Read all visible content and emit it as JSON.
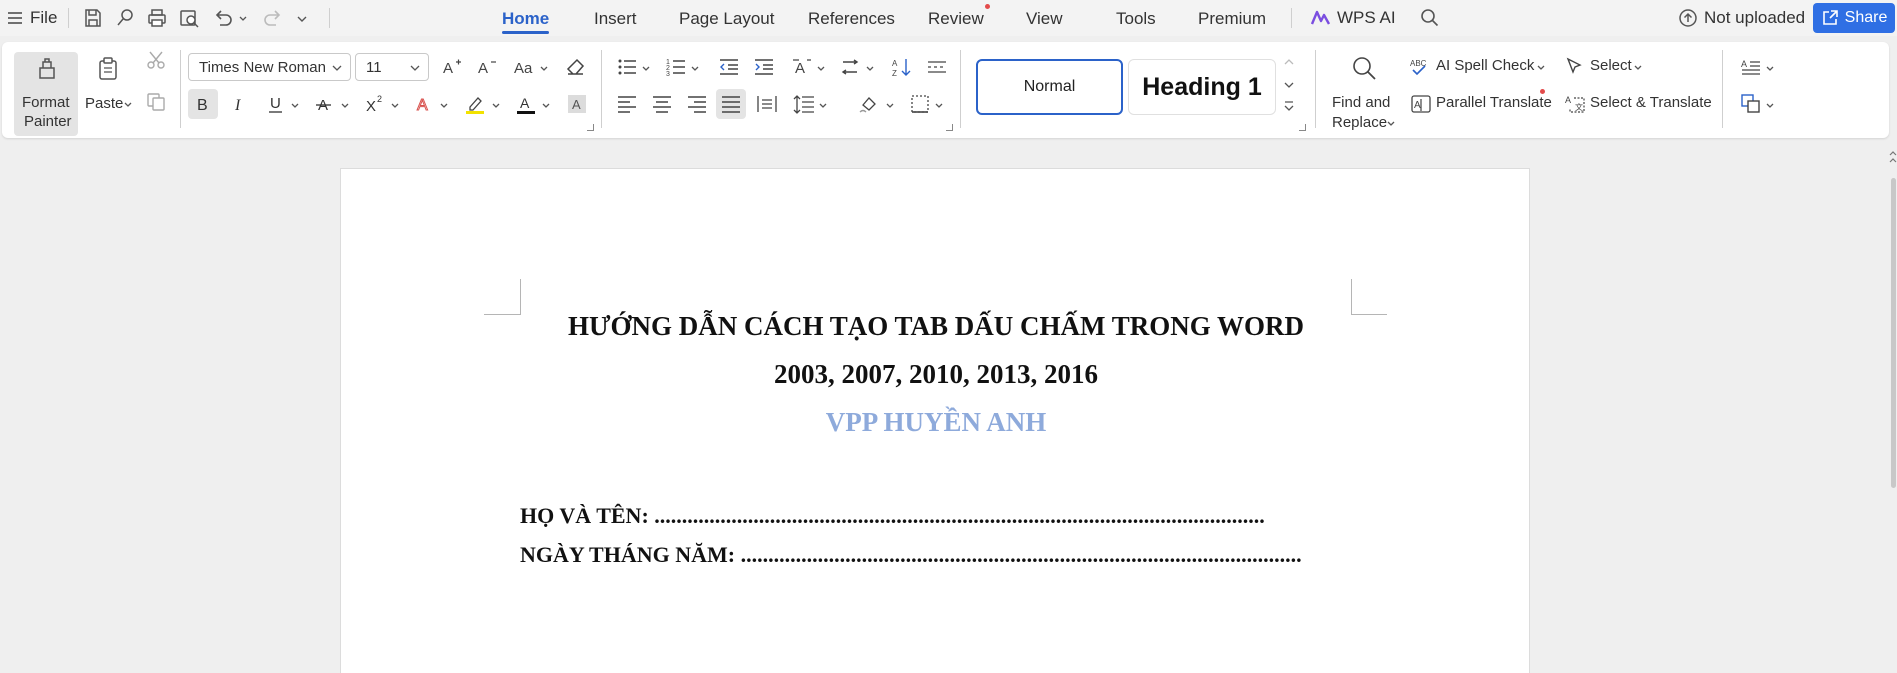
{
  "menubar": {
    "file_label": "File",
    "tabs": [
      {
        "label": "Home",
        "active": true
      },
      {
        "label": "Insert"
      },
      {
        "label": "Page Layout"
      },
      {
        "label": "References"
      },
      {
        "label": "Review"
      },
      {
        "label": "View"
      },
      {
        "label": "Tools"
      },
      {
        "label": "Premium"
      }
    ],
    "wps_ai_label": "WPS AI",
    "not_uploaded_label": "Not uploaded",
    "share_label": "Share"
  },
  "ribbon": {
    "format_painter_line1": "Format",
    "format_painter_line2": "Painter",
    "paste_label": "Paste",
    "font_name": "Times New Roman",
    "font_size": "11",
    "styles": {
      "normal": "Normal",
      "heading1": "Heading 1"
    },
    "find_replace_line1": "Find and",
    "find_replace_line2": "Replace",
    "ai_spell_check_label": "AI Spell Check",
    "select_label": "Select",
    "parallel_translate_label": "Parallel Translate",
    "select_translate_label": "Select & Translate"
  },
  "document": {
    "title_line1": "HƯỚNG DẪN CÁCH TẠO TAB DẤU CHẤM TRONG WORD",
    "title_line2": "2003, 2007, 2010, 2013, 2016",
    "subtitle": "VPP HUYỀN ANH",
    "fields": [
      {
        "label": "HỌ VÀ TÊN: ",
        "dots": "..............................................................................................................."
      },
      {
        "label": "NGÀY THÁNG NĂM: ",
        "dots": "......................................................................................................"
      }
    ]
  },
  "colors": {
    "accent": "#2b62c9",
    "share_button": "#2f6fe4",
    "subtitle": "#8eaadb",
    "dot_indicator": "#e34b4b"
  }
}
